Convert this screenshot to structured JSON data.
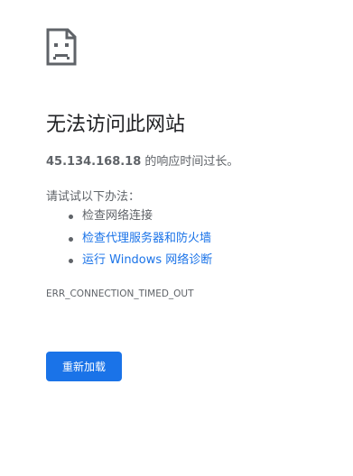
{
  "error_page": {
    "icon": "sad-page-icon",
    "title": "无法访问此网站",
    "summary": {
      "host": "45.134.168.18",
      "message": " 的响应时间过长。"
    },
    "suggestions_heading": "请试试以下办法：",
    "suggestions": [
      {
        "label": "检查网络连接",
        "is_link": false
      },
      {
        "label": "检查代理服务器和防火墙",
        "is_link": true
      },
      {
        "label": "运行 Windows 网络诊断",
        "is_link": true
      }
    ],
    "error_code": "ERR_CONNECTION_TIMED_OUT",
    "reload_button_label": "重新加载"
  },
  "colors": {
    "link": "#1a73e8",
    "button_bg": "#1a73e8",
    "text": "#5f6368",
    "title": "#202124"
  }
}
